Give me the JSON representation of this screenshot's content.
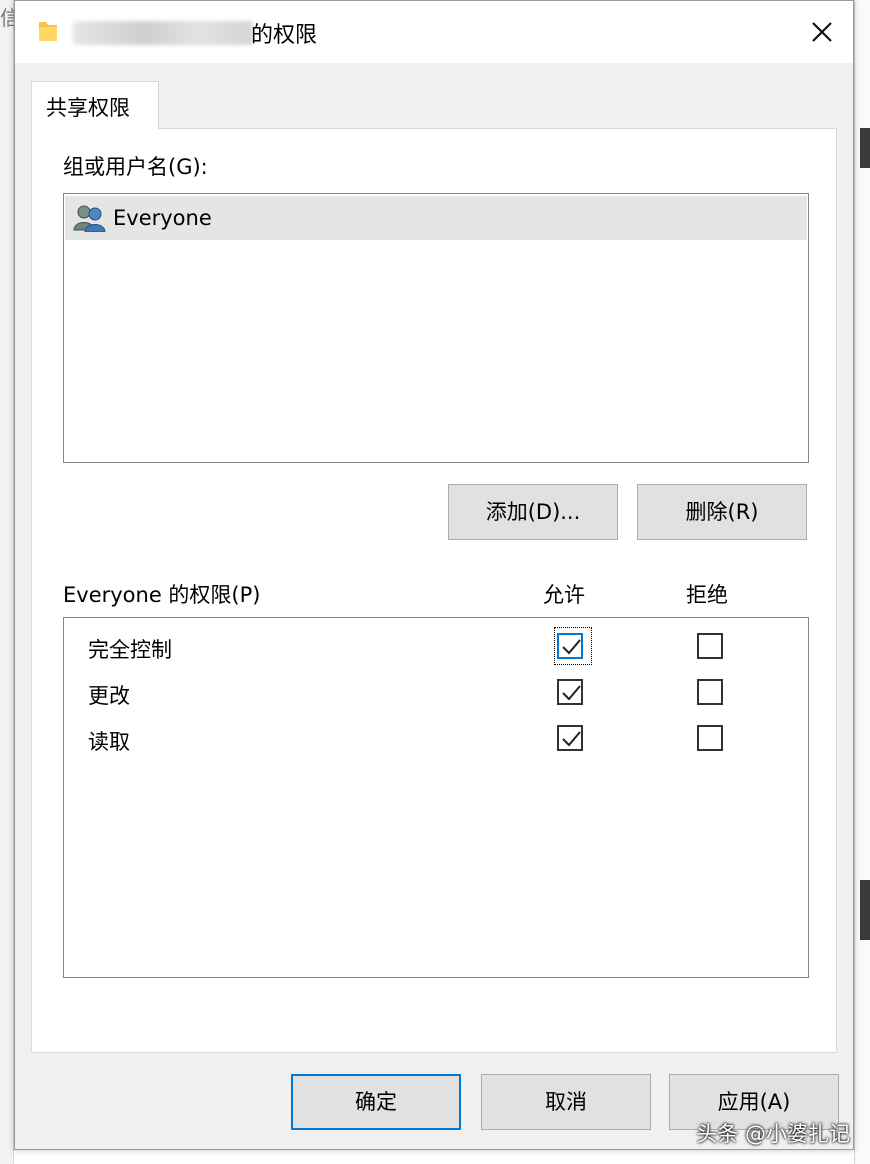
{
  "background": {
    "left_char": "信"
  },
  "window": {
    "title": "的权限",
    "close_label": "✕"
  },
  "tabs": [
    {
      "label": "共享权限",
      "selected": true
    }
  ],
  "groups": {
    "label": "组或用户名(G):",
    "items": [
      {
        "name": "Everyone",
        "icon": "users-group-icon",
        "selected": true
      }
    ]
  },
  "group_buttons": {
    "add": "添加(D)...",
    "remove": "删除(R)"
  },
  "permissions": {
    "label": "Everyone 的权限(P)",
    "allow_header": "允许",
    "deny_header": "拒绝",
    "rows": [
      {
        "name": "完全控制",
        "allow": true,
        "deny": false,
        "focused": true
      },
      {
        "name": "更改",
        "allow": true,
        "deny": false,
        "focused": false
      },
      {
        "name": "读取",
        "allow": true,
        "deny": false,
        "focused": false
      }
    ]
  },
  "footer": {
    "ok": "确定",
    "cancel": "取消",
    "apply": "应用(A)"
  },
  "watermark": "头条 @小婆扎记",
  "colors": {
    "accent": "#0078d7",
    "check": "#222222",
    "selection": "#e5e5e5"
  }
}
